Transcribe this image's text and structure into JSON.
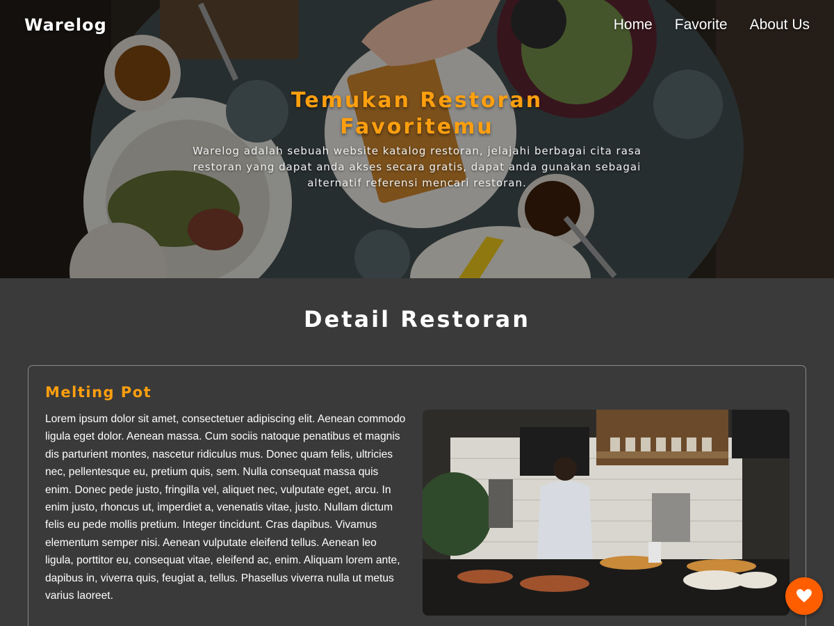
{
  "brand": {
    "name": "Warelog"
  },
  "nav": {
    "items": [
      {
        "label": "Home"
      },
      {
        "label": "Favorite"
      },
      {
        "label": "About Us"
      }
    ]
  },
  "hero": {
    "title": "Temukan Restoran Favoritemu",
    "description": "Warelog adalah sebuah website katalog restoran, jelajahi berbagai cita rasa restoran yang dapat anda akses secara gratis, dapat anda gunakan sebagai alternatif referensi mencari restoran."
  },
  "detail": {
    "section_title": "Detail Restoran",
    "restaurant": {
      "name": "Melting Pot",
      "description": "Lorem ipsum dolor sit amet, consectetuer adipiscing elit. Aenean commodo ligula eget dolor. Aenean massa. Cum sociis natoque penatibus et magnis dis parturient montes, nascetur ridiculus mus. Donec quam felis, ultricies nec, pellentesque eu, pretium quis, sem. Nulla consequat massa quis enim. Donec pede justo, fringilla vel, aliquet nec, vulputate eget, arcu. In enim justo, rhoncus ut, imperdiet a, venenatis vitae, justo. Nullam dictum felis eu pede mollis pretium. Integer tincidunt. Cras dapibus. Vivamus elementum semper nisi. Aenean vulputate eleifend tellus. Aenean leo ligula, porttitor eu, consequat vitae, eleifend ac, enim. Aliquam lorem ante, dapibus in, viverra quis, feugiat a, tellus. Phasellus viverra nulla ut metus varius laoreet."
    }
  },
  "fab": {
    "icon": "heart-icon"
  },
  "colors": {
    "accent": "#ff9f0f",
    "fab": "#ff5e00",
    "background": "#3a3a3a"
  }
}
